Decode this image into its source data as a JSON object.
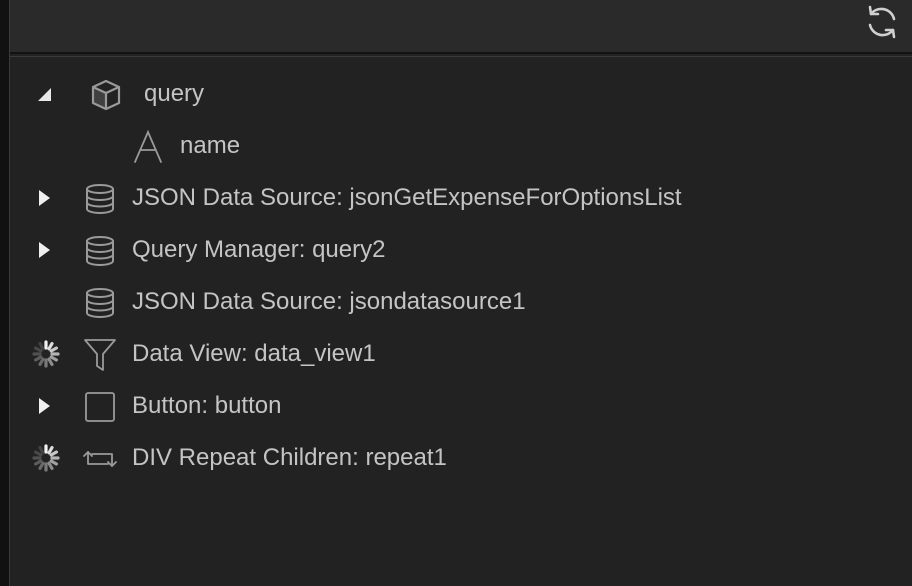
{
  "colors": {
    "background": "#222222",
    "header": "#2a2a2a",
    "text": "#c4c4c4",
    "icon": "#9a9a9a"
  },
  "header": {
    "refresh_icon": "refresh-icon"
  },
  "tree": {
    "items": [
      {
        "label": "query",
        "icon": "cube-icon",
        "toggle": "expanded"
      },
      {
        "label": "name",
        "icon": "text-letter-icon",
        "toggle": "none"
      },
      {
        "label": "JSON Data Source: jsonGetExpenseForOptionsList",
        "icon": "database-icon",
        "toggle": "collapsed"
      },
      {
        "label": "Query Manager: query2",
        "icon": "database-icon",
        "toggle": "collapsed"
      },
      {
        "label": "JSON Data Source: jsondatasource1",
        "icon": "database-icon",
        "toggle": "none"
      },
      {
        "label": "Data View: data_view1",
        "icon": "filter-icon",
        "toggle": "loading"
      },
      {
        "label": "Button: button",
        "icon": "square-icon",
        "toggle": "collapsed"
      },
      {
        "label": "DIV Repeat Children: repeat1",
        "icon": "repeat-icon",
        "toggle": "loading"
      }
    ]
  }
}
